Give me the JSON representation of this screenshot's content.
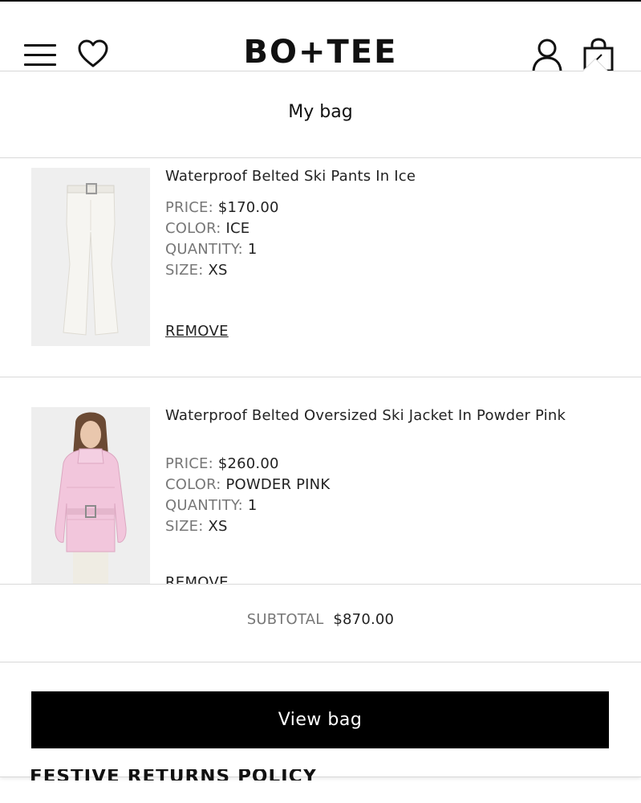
{
  "header": {
    "logo": "BO+TEE",
    "icons": [
      "menu-icon",
      "heart-icon",
      "account-icon",
      "bag-icon"
    ]
  },
  "bag": {
    "title": "My bag",
    "items": [
      {
        "name": "Waterproof Belted Ski Pants In Ice",
        "price_label": "PRICE:",
        "price": "$170.00",
        "color_label": "COLOR:",
        "color": "ICE",
        "quantity_label": "QUANTITY:",
        "quantity": "1",
        "size_label": "SIZE:",
        "size": "XS",
        "remove_label": "REMOVE"
      },
      {
        "name": "Waterproof Belted Oversized Ski Jacket In Powder Pink",
        "price_label": "PRICE:",
        "price": "$260.00",
        "color_label": "COLOR:",
        "color": "POWDER PINK",
        "quantity_label": "QUANTITY:",
        "quantity": "1",
        "size_label": "SIZE:",
        "size": "XS",
        "remove_label": "REMOVE"
      }
    ],
    "subtotal_label": "SUBTOTAL",
    "subtotal_value": "$870.00",
    "view_bag_label": "View bag"
  },
  "page_behind": {
    "partial_heading": "FESTIVE RETURNS POLICY"
  },
  "colors": {
    "button_bg": "#000000",
    "button_text": "#ffffff",
    "label_gray": "#777777",
    "divider": "#d9d9d9",
    "jacket_pink": "#f2c6dc",
    "pants_ice": "#f3f1ec"
  }
}
